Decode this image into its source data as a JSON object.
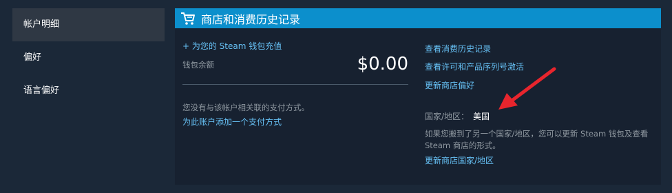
{
  "sidebar": {
    "items": [
      {
        "label": "帐户明细",
        "active": true
      },
      {
        "label": "偏好",
        "active": false
      },
      {
        "label": "语言偏好",
        "active": false
      }
    ]
  },
  "panel": {
    "icon": "shopping-cart-icon",
    "title": "商店和消费历史记录",
    "header_color": "#0c8fcc",
    "add_funds_link": "+ 为您的 Steam 钱包充值",
    "balance_label": "钱包余额",
    "balance_value": "$0.00",
    "no_payment_text": "您没有与该帐户相关联的支付方式。",
    "add_payment_link": "为此账户添加一个支付方式",
    "links": [
      "查看消费历史记录",
      "查看许可和产品序列号激活",
      "更新商店偏好"
    ],
    "country_label": "国家/地区：",
    "country_value": "美国",
    "country_note": "如果您搬到了另一个国家/地区，您可以更新 Steam 钱包及查看 Steam 商店的形式。",
    "update_country_link": "更新商店国家/地区"
  },
  "annotation": {
    "icon": "red-arrow-icon",
    "color": "#e8252d"
  }
}
